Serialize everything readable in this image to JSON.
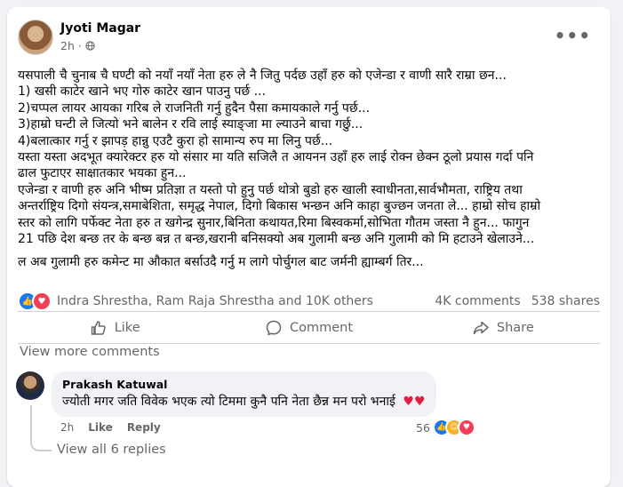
{
  "post": {
    "author": "Jyoti Magar",
    "time": "2h",
    "dot": "·",
    "more_icon": "•••",
    "lines": [
      "यसपाली चै चुनाब चै घण्टी को नयाँ नयाँ नेता हरु ले नै जितु पर्दछ उहाँ हरु को एजेन्डा र वाणी सारै राम्रा छन...",
      "1) खसी काटेर खाने भए गोरु काटेर खान पाउनु पर्छ ...",
      "2)चप्पल लायर आयका गरिब ले राजनिती गर्नु हुदैन पैसा कमायकाले गर्नु पर्छ...",
      "3)हाम्रो घन्टी ले जित्यो भने बालेन र रवि लाई स्याङ्जा मा ल्याउने बाचा गर्छु...",
      "4)बलात्कार गर्नु र झापड़ हान्नु एउटै कुरा हो सामान्य रुप मा लिनु पर्छ...",
      "यस्ता यस्ता अदभूत क्यारेक्टर हरु यो संसार मा यति सजिलै त आयनन उहाँ हरु लाई रोक्न छेक्न ठूलो प्रयास गर्दा पनि",
      "ढाल फुटाएर साक्षातकार भयका हुन...",
      "एजेन्डा र वाणी हरु अनि भीष्म प्रतिज्ञा त यस्तो पो हुनु पर्छ थोत्रो बुडो हरु खाली स्वाधीनता,सार्वभौमता, राष्ट्रिय तथा",
      "अन्तर्राष्ट्रिय दिगो संयन्त्र,समाबेशिता, समृद्ध नेपाल, दिगो बिकास भन्छन अनि काहा बुज्छन जनता ले... हाम्रो सोच हाम्रो",
      "स्तर को लागि पर्फेक्ट नेता हरु त खगेन्द्र सुनार,बिनिता कथायत,रिमा बिस्वकर्मा,सोभिता गौतम जस्ता नै हुन... फागुन",
      "21 पछि देश बन्छ तर के बन्छ बन्न त बन्छ,खरानी बनिसक्यो अब गुलामी बन्छ अनि गुलामी को मि हटाउने खेलाउने...",
      "ल अब गुलामी हरु कमेन्ट मा औकात बर्साउदै गर्नु म लागे पोर्चुगल बाट जर्मनी ह्याम्बर्ग तिर..."
    ]
  },
  "stats": {
    "reactors": "Indra Shrestha, Ram Raja Shrestha and 10K others",
    "comments": "4K comments",
    "shares": "538 shares",
    "icons": [
      "like-icon",
      "love-icon"
    ]
  },
  "actions": {
    "like": "Like",
    "comment": "Comment",
    "share": "Share"
  },
  "comments_section": {
    "view_more": "View more comments",
    "comment": {
      "name": "Prakash Katuwal",
      "text": "ज्योती मगर जति विवेक भएक त्यो टिममा कुनै पनि नेता छैन्न मन परो भनाई",
      "hearts": "♥♥",
      "time": "2h",
      "like": "Like",
      "reply": "Reply",
      "reaction_count": "56"
    },
    "view_replies": "View all 6 replies"
  },
  "colors": {
    "accent": "#1877f2",
    "love": "#f33e58",
    "muted": "#65676b",
    "background": "#f0f2f5"
  }
}
